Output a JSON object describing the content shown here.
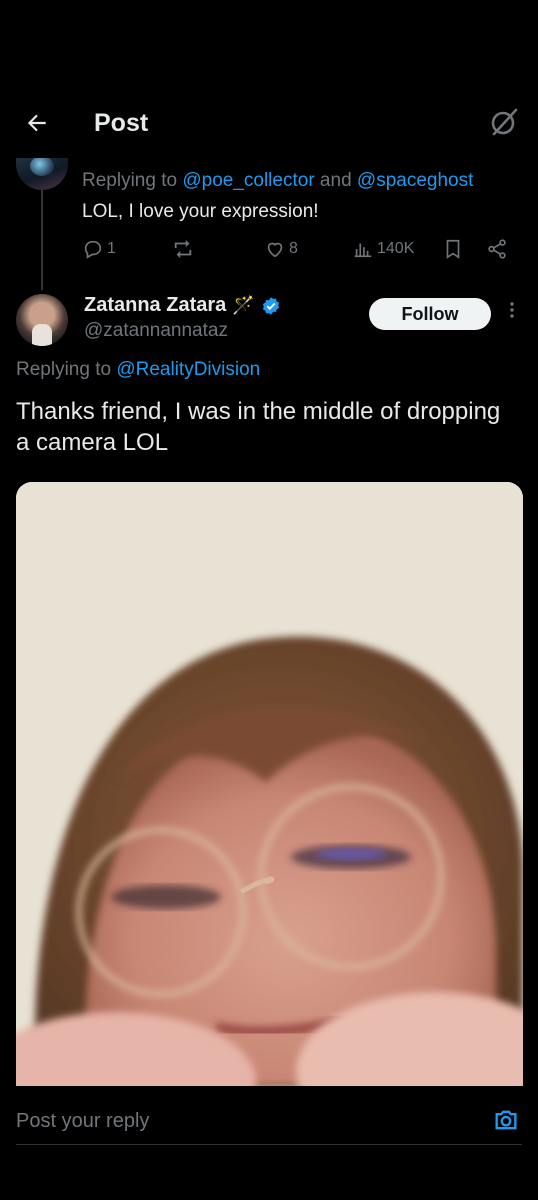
{
  "header": {
    "title": "Post"
  },
  "previous_reply": {
    "replying_prefix": "Replying to ",
    "mention_1": "@poe_collector",
    "conjunction": " and ",
    "mention_2": "@spaceghost",
    "text": "LOL, I love your expression!",
    "actions": {
      "replies": "1",
      "reposts": "",
      "likes": "8",
      "views": "140K"
    }
  },
  "main_post": {
    "author_name": "Zatanna Zatara",
    "author_handle": "@zatannannataz",
    "wand_emoji": "🪄",
    "follow_label": "Follow",
    "replying_prefix": "Replying to ",
    "mention": "@RealityDivision",
    "text": "Thanks friend, I was in the middle of dropping a camera LOL"
  },
  "reply_bar": {
    "placeholder": "Post your reply"
  },
  "colors": {
    "background": "#000000",
    "text_primary": "#e7e9ea",
    "text_secondary": "#71767b",
    "link": "#1d9bf0",
    "verified": "#1d9bf0"
  }
}
